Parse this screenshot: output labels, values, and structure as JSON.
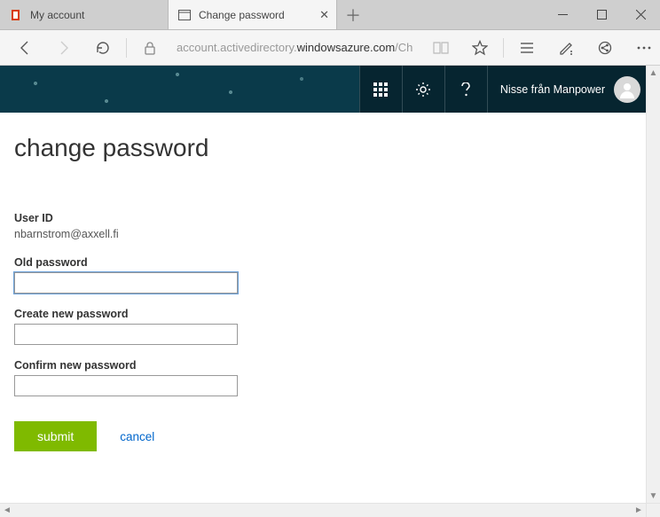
{
  "browser": {
    "tabs": [
      {
        "label": "My account"
      },
      {
        "label": "Change password"
      }
    ],
    "address_prefix": "account.activedirectory.",
    "address_host": "windowsazure.com",
    "address_suffix": "/Ch"
  },
  "banner": {
    "user_display_name": "Nisse från Manpower"
  },
  "page": {
    "title": "change password",
    "user_id_label": "User ID",
    "user_id_value": "nbarnstrom@axxell.fi",
    "old_password_label": "Old password",
    "new_password_label": "Create new password",
    "confirm_password_label": "Confirm new password",
    "old_password_value": "",
    "new_password_value": "",
    "confirm_password_value": "",
    "submit_label": "submit",
    "cancel_label": "cancel"
  }
}
